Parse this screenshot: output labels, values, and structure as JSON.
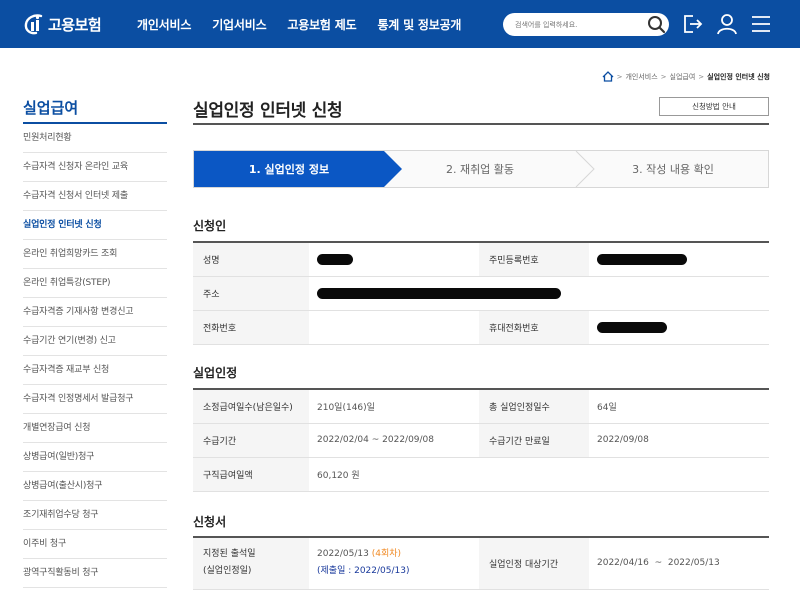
{
  "header": {
    "logo_text": "고용보험",
    "nav": [
      "개인서비스",
      "기업서비스",
      "고용보험 제도",
      "통계 및 정보공개"
    ],
    "search_placeholder": "검색어를 입력하세요."
  },
  "breadcrumb": {
    "items": [
      "개인서비스",
      "실업급여"
    ],
    "current": "실업인정 인터넷 신청"
  },
  "sidebar": {
    "title": "실업급여",
    "items": [
      "민원처리현황",
      "수급자격 신청자 온라인 교육",
      "수급자격 신청서 인터넷 제출",
      "실업인정 인터넷 신청",
      "온라인 취업희망카드 조회",
      "온라인 취업특강(STEP)",
      "수급자격증 기재사항 변경신고",
      "수급기간 연기(변경) 신고",
      "수급자격증 재교부 신청",
      "수급자격 인정명세서 발급청구",
      "개별연장급여 신청",
      "상병급여(일반)청구",
      "상병급여(출산시)청구",
      "조기재취업수당 청구",
      "이주비 청구",
      "광역구직활동비 청구"
    ],
    "active_index": 3
  },
  "main": {
    "title": "실업인정 인터넷 신청",
    "guide_button": "신청방법 안내",
    "steps": [
      "1. 실업인정 정보",
      "2. 재취업 활동",
      "3. 작성 내용 확인"
    ]
  },
  "applicant": {
    "title": "신청인",
    "name_label": "성명",
    "rrn_label": "주민등록번호",
    "address_label": "주소",
    "phone_label": "전화번호",
    "mobile_label": "휴대전화번호"
  },
  "recognition": {
    "title": "실업인정",
    "days_label": "소정급여일수(남은일수)",
    "days_value": "210일(146)일",
    "total_label": "총 실업인정일수",
    "total_value": "64일",
    "period_label": "수급기간",
    "period_value": "2022/02/04 ~ 2022/09/08",
    "end_label": "수급기간 만료일",
    "end_value": "2022/09/08",
    "pay_label": "구직급여일액",
    "pay_value": "60,120 원"
  },
  "application": {
    "title": "신청서",
    "attend_label_1": "지정된 출석일",
    "attend_label_2": "(실업인정일)",
    "attend_date": "2022/05/13",
    "attend_count": "(4회차)",
    "submit_text": "(제출일 : 2022/05/13)",
    "target_label": "실업인정 대상기간",
    "target_value": "2022/04/16  ~  2022/05/13"
  },
  "colors": {
    "brand": "#0b4ea2",
    "accent_orange": "#f08a24",
    "submit_navy": "#1a3a9c"
  }
}
